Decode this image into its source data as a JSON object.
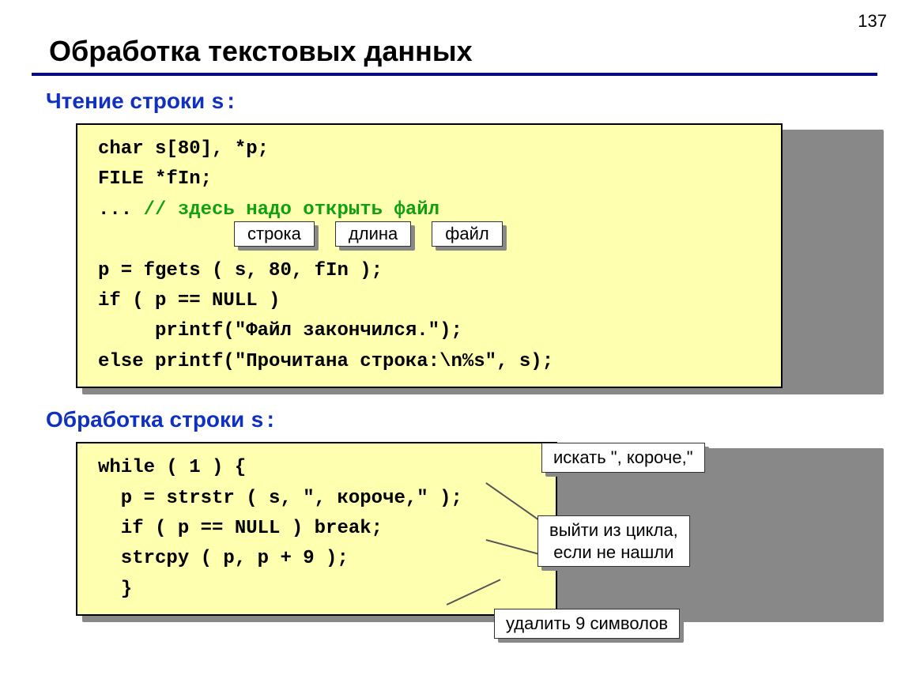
{
  "page_number": "137",
  "title": "Обработка текстовых данных",
  "section1": {
    "label_prefix": "Чтение строки ",
    "label_code": "s:",
    "code_l1": "char s[80], *p;",
    "code_l2": "FILE *fIn;",
    "code_l3a": "... ",
    "code_l3b": "// здесь надо открыть файл",
    "tag_a": "строка",
    "tag_b": "длина",
    "tag_c": "файл",
    "code_l4": "p = fgets ( s, 80, fIn );",
    "code_l5": "if ( p == NULL )",
    "code_l6": "     printf(\"Файл закончился.\");",
    "code_l7": "else printf(\"Прочитана строка:\\n%s\", s);"
  },
  "section2": {
    "label_prefix": "Обработка строки ",
    "label_code": "s:",
    "code_l1": "while ( 1 ) {",
    "code_l2": "  p = strstr ( s, \", короче,\" );",
    "code_l3": "  if ( p == NULL ) break;",
    "code_l4": "  strcpy ( p, p + 9 );",
    "code_l5": "  }",
    "callout1": "искать \", короче,\"",
    "callout2_l1": "выйти из цикла,",
    "callout2_l2": "если не нашли",
    "callout3": "удалить 9 символов"
  }
}
